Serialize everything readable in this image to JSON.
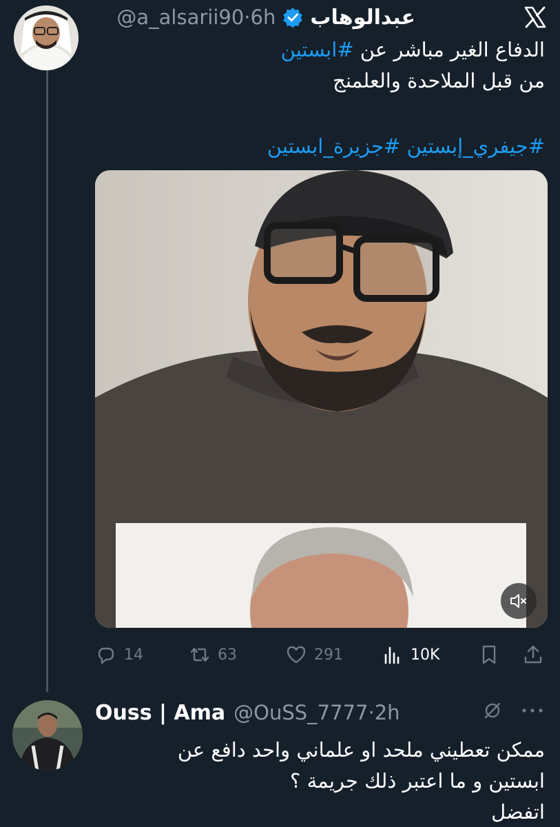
{
  "tweet": {
    "display_name": "عبدالوهاب",
    "handle": "@a_alsarii90",
    "time": "6h",
    "line1_prefix": "الدفاع الغير مباشر عن ",
    "line1_hashtag": "#ابستين",
    "line2": "من قبل الملاحدة والعلمنج",
    "hashtags_line": "#جيفري_إبستين #جزيرة_ابستين",
    "stats": {
      "replies": "14",
      "retweets": "63",
      "likes": "291",
      "views": "10K"
    }
  },
  "reply": {
    "display_name": "Ouss | Ama",
    "handle": "@OuSS_7777",
    "time": "2h",
    "text_lines": [
      "ممكن تعطيني ملحد او علماني واحد دافع عن",
      "ابستين و ما اعتبر ذلك جريمة ؟",
      "اتفضل"
    ]
  },
  "colors": {
    "background": "#15202b",
    "accent": "#1d9bf0",
    "secondary_text": "#8b98a5",
    "verified_badge": "#1d9bf0"
  },
  "icons": [
    "x-logo-icon",
    "verified-badge-icon",
    "speaker-muted-icon",
    "reply-icon",
    "retweet-icon",
    "like-icon",
    "views-icon",
    "bookmark-icon",
    "share-icon",
    "grok-icon",
    "more-icon"
  ]
}
